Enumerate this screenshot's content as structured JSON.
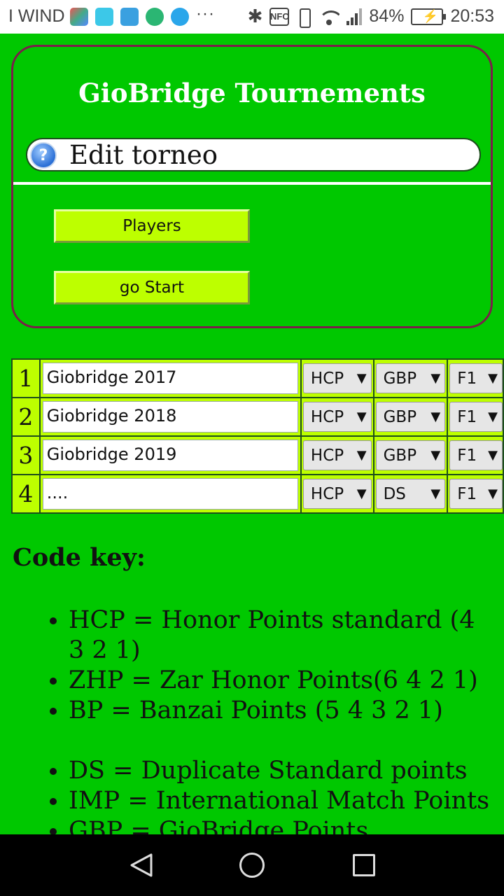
{
  "status_bar": {
    "carrier": "I WIND",
    "battery_percent": "84%",
    "time": "20:53",
    "nfc_label": "NFC",
    "battery_level": 0.84,
    "icons": [
      "app-notification-icon",
      "heart-app-icon",
      "usb-icon",
      "globe-icon",
      "messenger-icon",
      "more-notifications-icon",
      "bluetooth-icon",
      "nfc-icon",
      "vibrate-icon",
      "wifi-icon",
      "signal-icon",
      "battery-icon"
    ]
  },
  "header": {
    "title": "GioBridge Tournements",
    "edit_title": "Edit torneo",
    "help_icon_label": "?"
  },
  "buttons": {
    "players_label": "Players",
    "start_label": "go Start"
  },
  "tournaments": [
    {
      "num": "1",
      "name": "Giobridge 2017",
      "points": "HCP",
      "scoring": "GBP",
      "format": "F1"
    },
    {
      "num": "2",
      "name": "Giobridge 2018",
      "points": "HCP",
      "scoring": "GBP",
      "format": "F1"
    },
    {
      "num": "3",
      "name": "Giobridge 2019",
      "points": "HCP",
      "scoring": "GBP",
      "format": "F1"
    },
    {
      "num": "4",
      "name": "....",
      "points": "HCP",
      "scoring": "DS",
      "format": "F1"
    }
  ],
  "code_key": {
    "title": "Code key:",
    "honor_points": [
      "HCP = Honor Points standard (4 3 2 1)",
      "ZHP = Zar Honor Points(6 4 2 1)",
      "BP = Banzai Points (5 4 3 2 1)"
    ],
    "scoring": [
      "DS = Duplicate Standard points",
      "IMP = International Match Points",
      "GBP = GioBridge Points"
    ]
  },
  "colors": {
    "background": "#00c800",
    "accent": "#bdff00",
    "card_border": "#7a1f4a"
  }
}
